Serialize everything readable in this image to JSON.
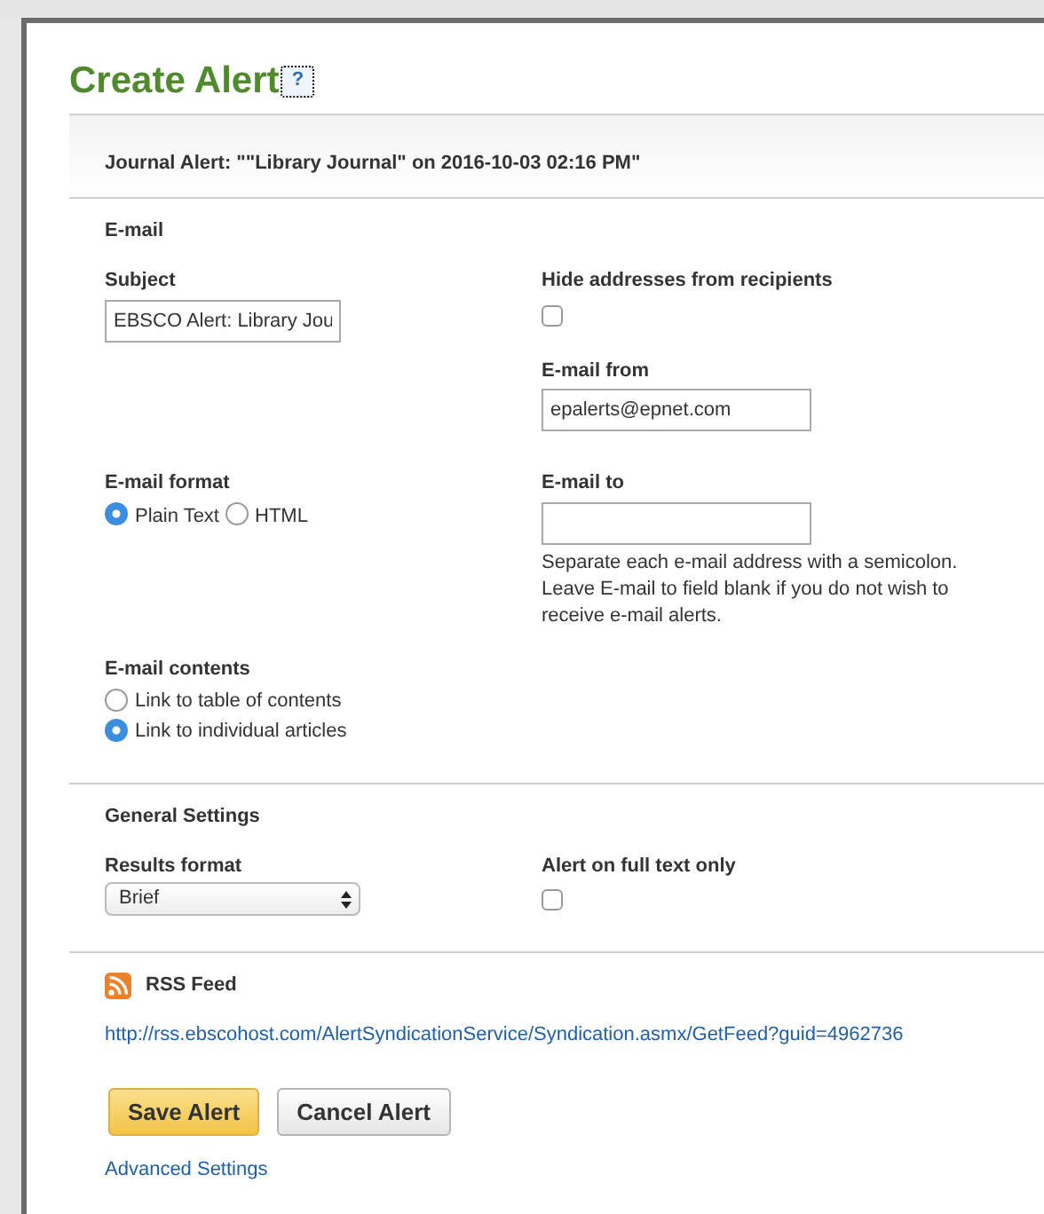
{
  "title": "Create Alert",
  "help_button": "?",
  "alert_name": "Journal Alert: \"\"Library Journal\" on 2016-10-03 02:16 PM\"",
  "email_section": {
    "heading": "E-mail",
    "subject": {
      "label": "Subject",
      "value": "EBSCO Alert: Library Jou"
    },
    "hide_addresses": {
      "label": "Hide addresses from recipients",
      "checked": false
    },
    "email_from": {
      "label": "E-mail from",
      "value": "epalerts@epnet.com"
    },
    "email_format": {
      "label": "E-mail format",
      "options": [
        {
          "label": "Plain Text",
          "selected": true
        },
        {
          "label": "HTML",
          "selected": false
        }
      ]
    },
    "email_to": {
      "label": "E-mail to",
      "help": "Separate each e-mail address with a semicolon. Leave E-mail to field blank if you do not wish to receive e-mail alerts."
    },
    "email_contents": {
      "label": "E-mail contents",
      "options": [
        {
          "label": "Link to table of contents",
          "selected": false
        },
        {
          "label": "Link to individual articles",
          "selected": true
        }
      ]
    }
  },
  "general_settings": {
    "heading": "General Settings",
    "results_format": {
      "label": "Results format",
      "value": "Brief"
    },
    "full_text_only": {
      "label": "Alert on full text only",
      "checked": false
    }
  },
  "rss": {
    "heading": "RSS Feed",
    "url": "http://rss.ebscohost.com/AlertSyndicationService/Syndication.asmx/GetFeed?guid=4962736"
  },
  "buttons": [
    {
      "label": "Save Alert",
      "kind": "primary"
    },
    {
      "label": "Cancel Alert",
      "kind": "secondary"
    }
  ],
  "advanced_link": "Advanced Settings"
}
